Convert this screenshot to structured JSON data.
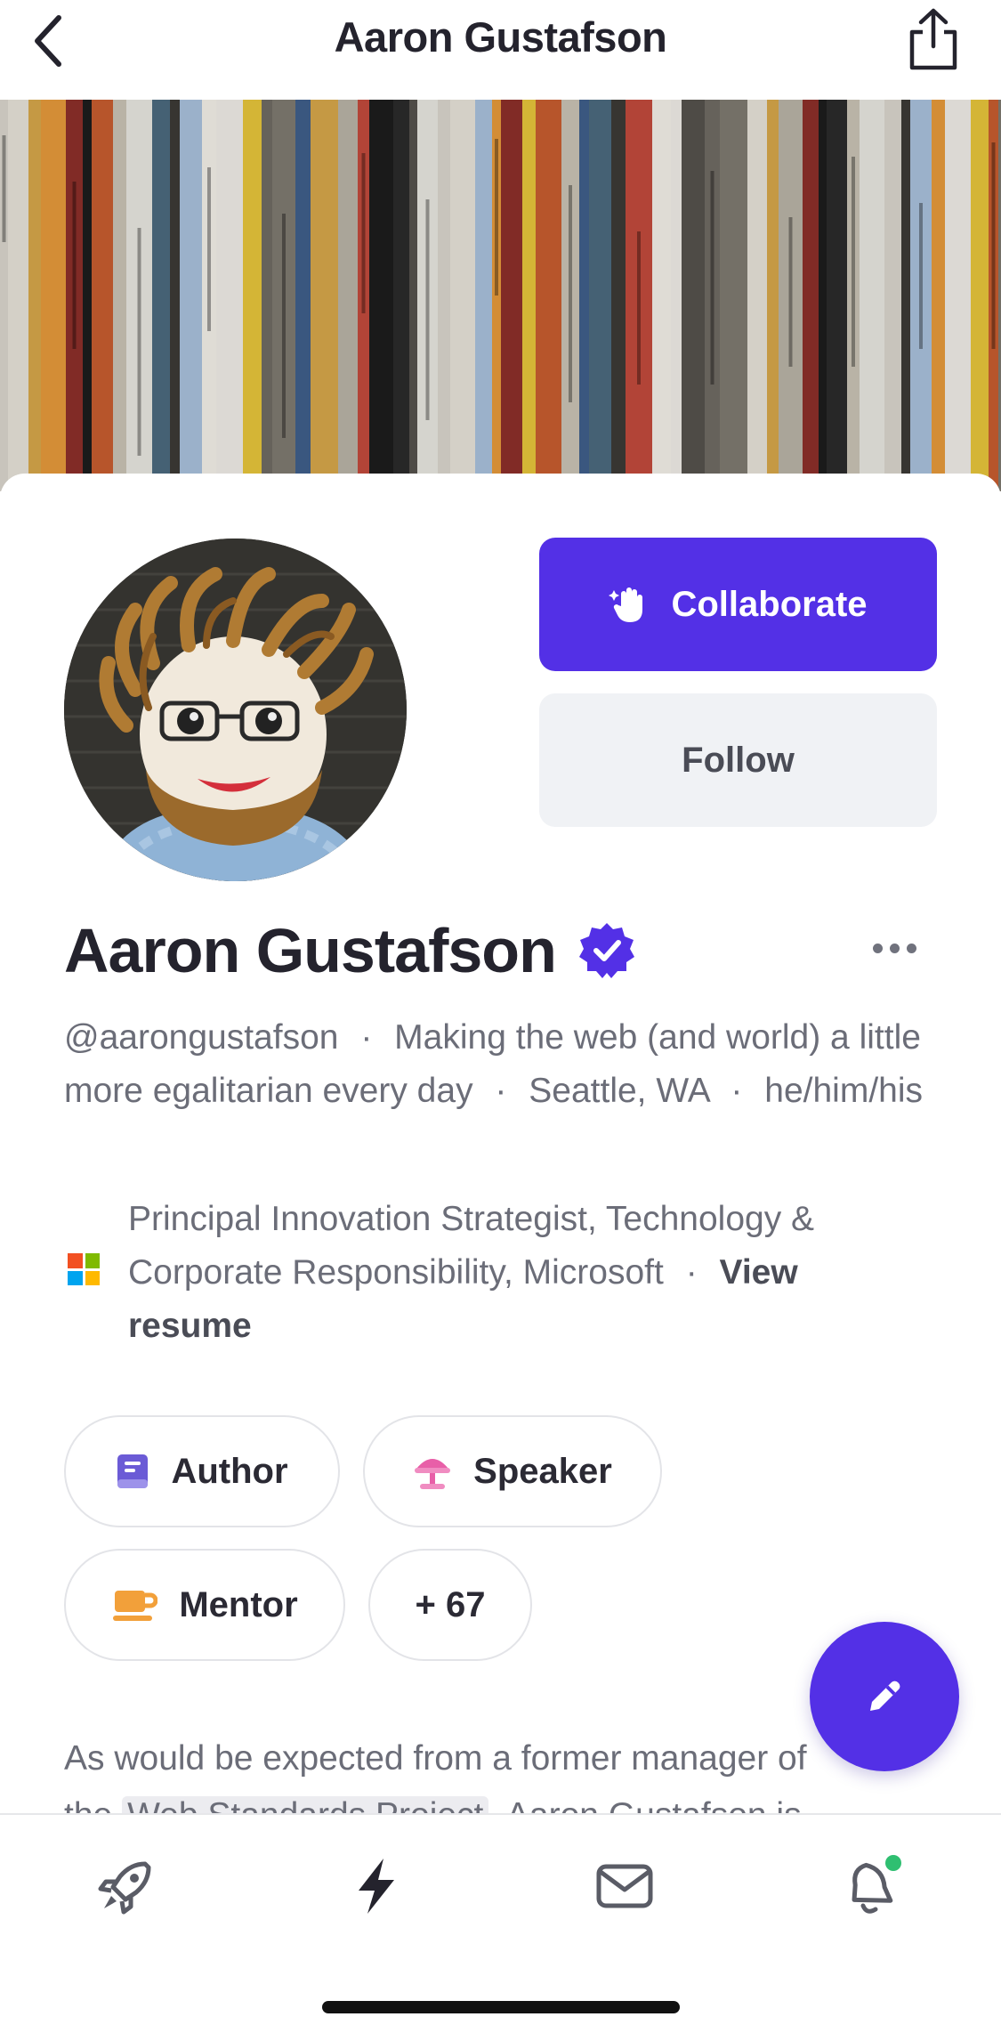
{
  "header": {
    "title": "Aaron Gustafson",
    "back_icon": "chevron-left-icon",
    "share_icon": "share-icon"
  },
  "profile": {
    "name": "Aaron Gustafson",
    "verified_icon": "verified-badge-icon",
    "collaborate_label": "Collaborate",
    "follow_label": "Follow",
    "handle": "@aarongustafson",
    "tagline": "Making the web (and world) a little more egalitarian every day",
    "location": "Seattle, WA",
    "pronouns": "he/him/his",
    "separator": "·",
    "job_title": "Principal Innovation Strategist, Technology & Corporate Responsibility, Microsoft",
    "view_resume": "View resume",
    "about_line1": "As would be expected from a former manager of",
    "about_line2_prefix": "the",
    "about_line2_highlight": "Web Standards Project",
    "about_line2_suffix": ", Aaron Gustafson is"
  },
  "tags": [
    {
      "label": "Author",
      "icon": "book-icon"
    },
    {
      "label": "Speaker",
      "icon": "podium-icon"
    },
    {
      "label": "Mentor",
      "icon": "coffee-cup-icon"
    },
    {
      "label": "+ 67"
    }
  ],
  "colors": {
    "accent": "#5330e6",
    "follow_bg": "#f0f2f5",
    "text_primary": "#24232d",
    "text_secondary": "#6b6d78",
    "notification_dot": "#2fbf71"
  },
  "tabbar": {
    "items": [
      "rocket-icon",
      "lightning-icon",
      "envelope-icon",
      "bell-icon"
    ]
  }
}
